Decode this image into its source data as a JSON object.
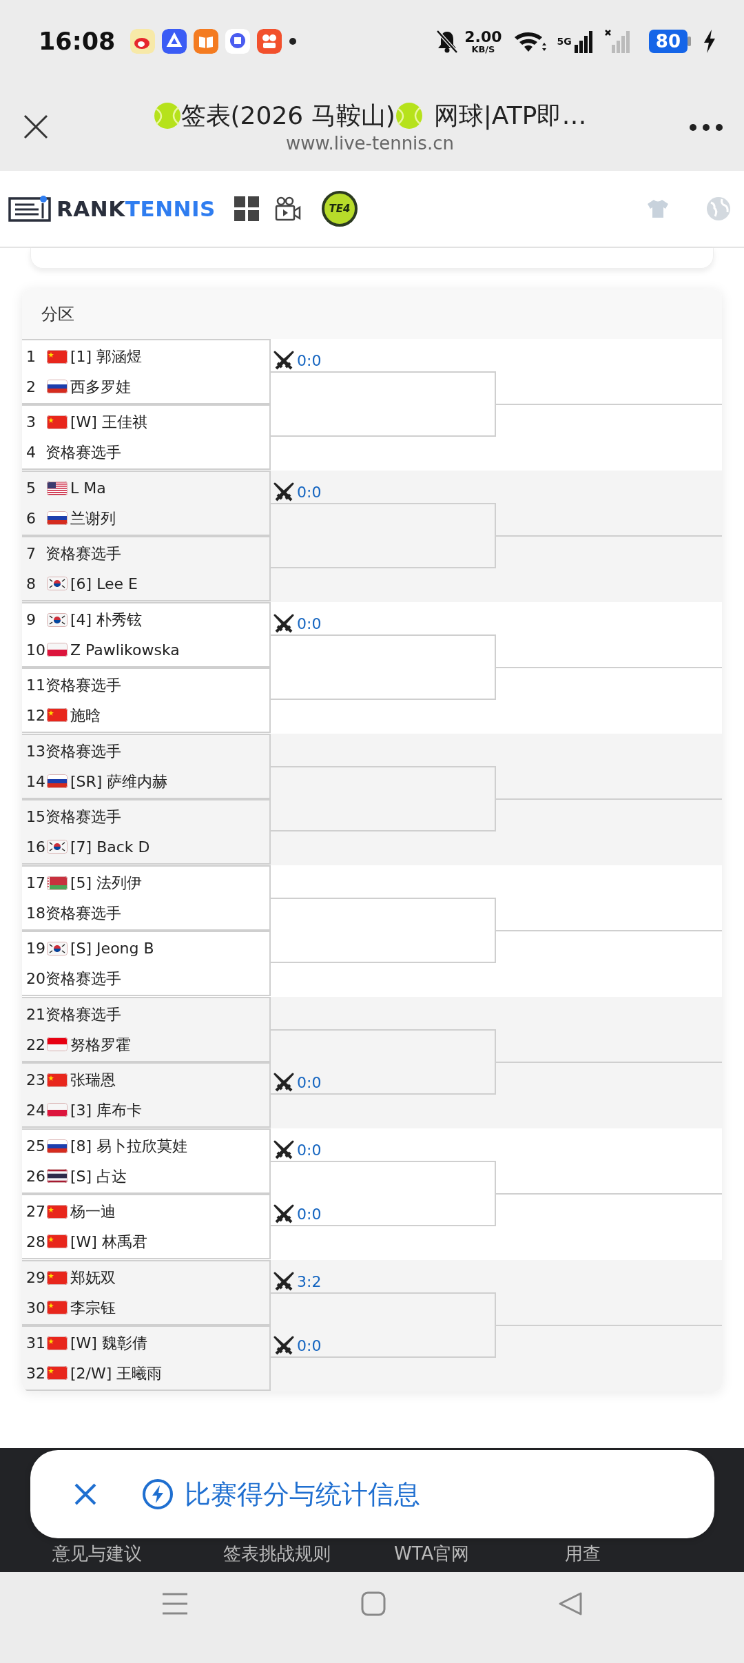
{
  "status_bar": {
    "time": "16:08",
    "net_speed": "2.00",
    "net_unit": "KB/S",
    "network": "5G",
    "battery": "80"
  },
  "browser": {
    "title_1": "签表(2026 马鞍山)",
    "title_2": "网球|ATP即…",
    "url": "www.live-tennis.cn"
  },
  "site_header": {
    "logo_1": "RANK",
    "logo_2": "TENNIS",
    "badge": "TE4"
  },
  "bracket": {
    "header": "分区",
    "groups": [
      {
        "matches": [
          {
            "score": "0:0",
            "players": [
              {
                "no": "1",
                "kind": "china",
                "name": "[1] 郭涵煜"
              },
              {
                "no": "2",
                "kind": "russia",
                "name": "西多罗娃"
              }
            ]
          },
          {
            "players": [
              {
                "no": "3",
                "kind": "china",
                "name": "[W] 王佳祺"
              },
              {
                "no": "4",
                "name": "资格赛选手"
              }
            ]
          }
        ]
      },
      {
        "matches": [
          {
            "score": "0:0",
            "players": [
              {
                "no": "5",
                "kind": "usa",
                "name": "L Ma"
              },
              {
                "no": "6",
                "kind": "russia",
                "name": "兰谢列"
              }
            ]
          },
          {
            "players": [
              {
                "no": "7",
                "name": "资格赛选手"
              },
              {
                "no": "8",
                "kind": "korea",
                "name": "[6] Lee E"
              }
            ]
          }
        ]
      },
      {
        "matches": [
          {
            "score": "0:0",
            "players": [
              {
                "no": "9",
                "kind": "korea",
                "name": "[4] 朴秀铉"
              },
              {
                "no": "10",
                "kind": "poland",
                "name": "Z Pawlikowska"
              }
            ]
          },
          {
            "players": [
              {
                "no": "11",
                "name": "资格赛选手"
              },
              {
                "no": "12",
                "kind": "china",
                "name": "施晗"
              }
            ]
          }
        ]
      },
      {
        "matches": [
          {
            "players": [
              {
                "no": "13",
                "name": "资格赛选手"
              },
              {
                "no": "14",
                "kind": "russia",
                "name": "[SR] 萨维内赫"
              }
            ]
          },
          {
            "players": [
              {
                "no": "15",
                "name": "资格赛选手"
              },
              {
                "no": "16",
                "kind": "korea",
                "name": "[7] Back D"
              }
            ]
          }
        ]
      },
      {
        "matches": [
          {
            "players": [
              {
                "no": "17",
                "kind": "belarus",
                "name": "[5] 法列伊"
              },
              {
                "no": "18",
                "name": "资格赛选手"
              }
            ]
          },
          {
            "players": [
              {
                "no": "19",
                "kind": "korea",
                "name": "[S] Jeong B"
              },
              {
                "no": "20",
                "name": "资格赛选手"
              }
            ]
          }
        ]
      },
      {
        "matches": [
          {
            "players": [
              {
                "no": "21",
                "name": "资格赛选手"
              },
              {
                "no": "22",
                "kind": "indonesia",
                "name": "努格罗霍"
              }
            ]
          },
          {
            "score": "0:0",
            "players": [
              {
                "no": "23",
                "kind": "china",
                "name": "张瑞恩"
              },
              {
                "no": "24",
                "kind": "poland",
                "name": "[3] 库布卡"
              }
            ]
          }
        ]
      },
      {
        "matches": [
          {
            "score": "0:0",
            "players": [
              {
                "no": "25",
                "kind": "russia",
                "name": "[8] 易卜拉欣莫娃"
              },
              {
                "no": "26",
                "kind": "thailand",
                "name": "[S] 占达"
              }
            ]
          },
          {
            "score": "0:0",
            "players": [
              {
                "no": "27",
                "kind": "china",
                "name": "杨一迪"
              },
              {
                "no": "28",
                "kind": "china",
                "name": "[W] 林禹君"
              }
            ]
          }
        ]
      },
      {
        "matches": [
          {
            "score": "3:2",
            "players": [
              {
                "no": "29",
                "kind": "china",
                "name": "郑妩双"
              },
              {
                "no": "30",
                "kind": "china",
                "name": "李宗钰"
              }
            ]
          },
          {
            "score": "0:0",
            "players": [
              {
                "no": "31",
                "kind": "china",
                "name": "[W] 魏彰倩"
              },
              {
                "no": "32",
                "kind": "china",
                "name": "[2/W] 王曦雨"
              }
            ]
          }
        ]
      }
    ]
  },
  "footer_links": [
    "意见与建议",
    "签表挑战规则",
    "WTA官网",
    "用查"
  ],
  "popup": {
    "text": "比赛得分与统计信息"
  }
}
